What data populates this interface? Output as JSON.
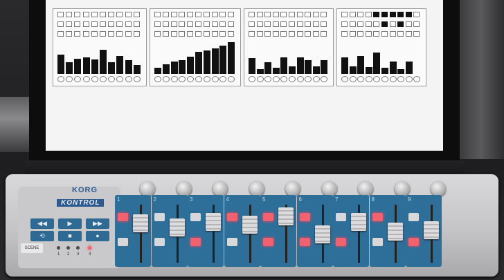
{
  "controller": {
    "brand": "KORG",
    "model": "KONTROL",
    "channels": [
      "1",
      "2",
      "3",
      "4",
      "5",
      "6",
      "7",
      "8",
      "9"
    ],
    "transport": [
      "◀◀",
      "▶",
      "▶▶",
      "⟲",
      "■",
      "●"
    ],
    "scene_label": "SCENE",
    "scene_numbers": [
      "1",
      "2",
      "3",
      "4"
    ],
    "active_scene_led": 4
  },
  "sequencer": {
    "panels": [
      {
        "bars": [
          0.85,
          0.5,
          0.68,
          0.72,
          0.65,
          1.05,
          0.5,
          0.78,
          0.6,
          0.38
        ],
        "top_on": []
      },
      {
        "bars": [
          0.28,
          0.42,
          0.55,
          0.62,
          0.75,
          0.98,
          1.02,
          1.12,
          1.25,
          1.38
        ],
        "top_on": []
      },
      {
        "bars": [
          0.7,
          0.22,
          0.52,
          0.28,
          0.72,
          0.32,
          0.72,
          0.62,
          0.32,
          0.6
        ],
        "top_on": []
      },
      {
        "bars": [
          0.72,
          0.32,
          0.8,
          0.3,
          0.95,
          0.28,
          0.55,
          0.22,
          0.55,
          0.0
        ],
        "top_on": [
          4,
          5,
          6,
          7,
          8
        ]
      }
    ]
  },
  "colors": {
    "panel_blue": "#2e6f9a",
    "led_red": "#f0626f",
    "screen_white": "#f4f4f4"
  }
}
